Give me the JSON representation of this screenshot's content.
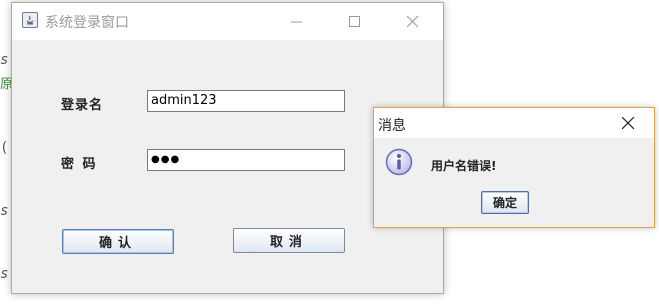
{
  "background": {
    "fragments": [
      "s",
      "原",
      "(",
      "s",
      "s"
    ],
    "fragment_colors": [
      "#555555",
      "#3a8a3a",
      "#555555",
      "#555555",
      "#555555"
    ]
  },
  "login_window": {
    "title": "系统登录窗口",
    "icon": "java-app-icon",
    "controls": [
      "minimize-icon",
      "maximize-icon",
      "close-icon"
    ],
    "username_label": "登录名",
    "username_value": "admin123",
    "password_label": "密 码",
    "password_value": "●●●",
    "confirm_label": "确认",
    "cancel_label": "取消"
  },
  "message_dialog": {
    "title": "消息",
    "icon": "info-icon",
    "message": "用户名错误!",
    "ok_label": "确定"
  },
  "colors": {
    "window_bg": "#f0f0f0",
    "dialog_border": "#e5a24a",
    "info_icon": "#6a6ab8"
  }
}
